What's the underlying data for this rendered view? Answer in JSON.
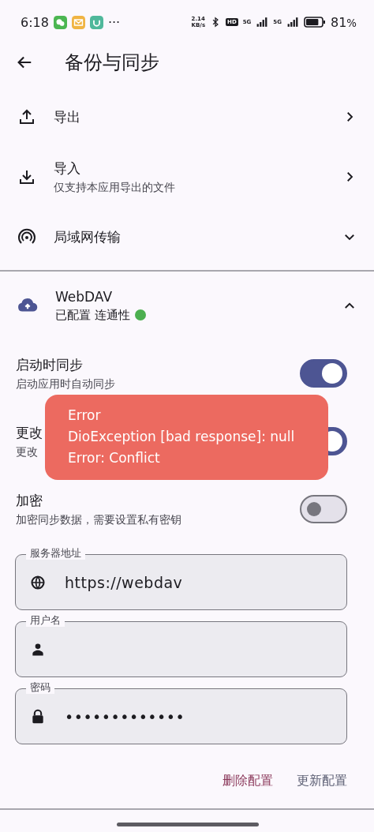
{
  "status_bar": {
    "time": "6:18",
    "more": "···",
    "speed_value": "2.14",
    "speed_unit": "KB/s",
    "hd": "HD",
    "network_1": "5G",
    "network_2": "5G",
    "battery": "81",
    "battery_unit": "%"
  },
  "header": {
    "title": "备份与同步"
  },
  "items": [
    {
      "kind": "export",
      "title": "导出"
    },
    {
      "kind": "import",
      "title": "导入",
      "subtitle": "仅支持本应用导出的文件"
    },
    {
      "kind": "lan",
      "title": "局域网传输"
    }
  ],
  "webdav": {
    "title": "WebDAV",
    "status": "已配置 连通性",
    "connected": true,
    "expanded": true,
    "settings": [
      {
        "title": "启动时同步",
        "subtitle": "启动应用时自动同步",
        "on": true
      },
      {
        "title": "更改",
        "subtitle": "更改",
        "on": true
      },
      {
        "title": "加密",
        "subtitle": "加密同步数据，需要设置私有密钥",
        "on": false
      }
    ],
    "fields": [
      {
        "kind": "globe",
        "label": "服务器地址",
        "value": "https://webdav"
      },
      {
        "kind": "person",
        "label": "用户名"
      },
      {
        "kind": "lock",
        "label": "密码",
        "value": "•••••••••••••"
      }
    ],
    "actions": [
      {
        "label": "删除配置",
        "kind": "danger"
      },
      {
        "label": "更新配置",
        "kind": "normal"
      }
    ]
  },
  "toast": {
    "lines": [
      "Error",
      "DioException [bad response]: null",
      "Error: Conflict"
    ]
  }
}
